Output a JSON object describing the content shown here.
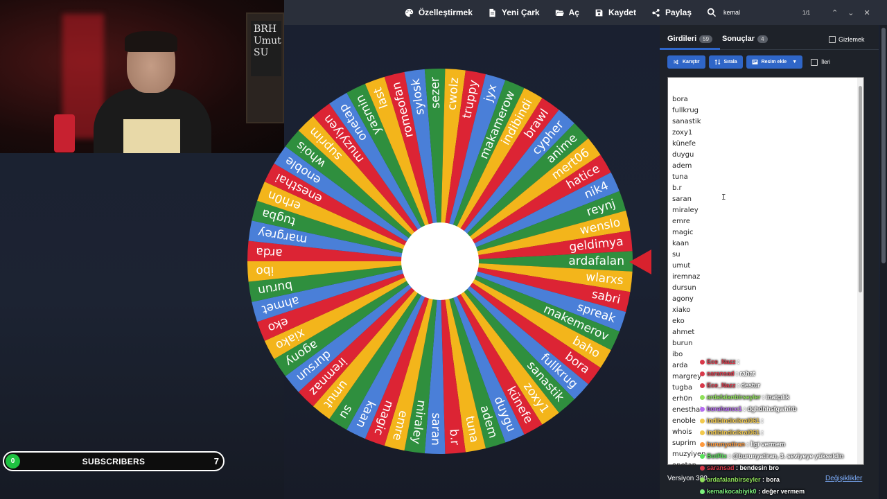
{
  "toolbar": {
    "customize_label": "Özelleştirmek",
    "new_wheel_label": "Yeni Çark",
    "open_label": "Aç",
    "save_label": "Kaydet",
    "share_label": "Paylaş",
    "search_value": "kemal",
    "search_count": "1/1"
  },
  "tabs": {
    "entries_label": "Girdileri",
    "entries_count": "59",
    "results_label": "Sonuçlar",
    "results_count": "4",
    "hide_label": "Gizlemek"
  },
  "actions": {
    "shuffle_label": "Karıştır",
    "sort_label": "Sırala",
    "add_image_label": "Resim ekle",
    "advanced_label": "İleri"
  },
  "entries": [
    "bora",
    "fullkrug",
    "sanastik",
    "zoxy1",
    "künefe",
    "duygu",
    "adem",
    "tuna",
    "b.r",
    "saran",
    "miraley",
    "emre",
    "magic",
    "kaan",
    "su",
    "umut",
    "iremnaz",
    "dursun",
    "agony",
    "xiako",
    "eko",
    "ahmet",
    "burun",
    "ibo",
    "arda",
    "margrey",
    "tugba",
    "erh0n",
    "enesthai",
    "enoble",
    "whois",
    "suprim",
    "muzyiyen",
    "onetap"
  ],
  "wheel": {
    "pointer_color": "#d8222e",
    "colors": [
      "#2f8f3e",
      "#f3b51b",
      "#dc2434",
      "#4a7fd8"
    ],
    "segments": [
      "ardafalan",
      "wlarxs",
      "sabri",
      "spreak",
      "makemerov",
      "baho",
      "bora",
      "fullkrug",
      "sanastik",
      "zoxy1",
      "künefe",
      "duygu",
      "adem",
      "tuna",
      "b.r",
      "saran",
      "miraley",
      "emre",
      "magic",
      "kaan",
      "su",
      "umut",
      "iremnaz",
      "dursun",
      "agony",
      "xiako",
      "eko",
      "ahmet",
      "burun",
      "ibo",
      "arda",
      "margrey",
      "tugba",
      "erh0n",
      "enesthai",
      "enoble",
      "whois",
      "suprim",
      "muzyiyen",
      "onetap",
      "yasmin",
      "last",
      "romeofan",
      "sylosk",
      "sezer",
      "cwolz",
      "truppy",
      "jyx",
      "makamerow",
      "indibindi",
      "brawl",
      "cypher",
      "anime",
      "mert06",
      "hatice",
      "nik4",
      "reynj",
      "wenslo",
      "geldimya"
    ]
  },
  "footer": {
    "version_label": "Versiyon 380",
    "changes_label": "Değişiklikler"
  },
  "chat": [
    {
      "user": "Ece_Nazz",
      "color": "#d8394a",
      "msg": ""
    },
    {
      "user": "saransad",
      "color": "#d8394a",
      "msg": "rahat"
    },
    {
      "user": "Ece_Nazz",
      "color": "#d8394a",
      "msg": "destur"
    },
    {
      "user": "ardafalanbirseyler",
      "color": "#8fe05a",
      "msg": "inatçılık"
    },
    {
      "user": "borahancc1",
      "color": "#b66bf2",
      "msg": "dghdhhsfgwhfrb"
    },
    {
      "user": "indibindicikral061",
      "color": "#f2c94c",
      "msg": ""
    },
    {
      "user": "indibindicikral061",
      "color": "#f2c94c",
      "msg": ""
    },
    {
      "user": "burunyatiran",
      "color": "#ff9a3d",
      "msg": "İlgi vermem"
    },
    {
      "user": "BotRix",
      "color": "#58e25a",
      "msg": "@burunyatiran, 3. seviyeye yükseldin"
    },
    {
      "user": "saransad",
      "color": "#d8394a",
      "msg": "bendesin bro"
    },
    {
      "user": "ardafalanbirseyler",
      "color": "#8fe05a",
      "msg": "bora"
    },
    {
      "user": "kemalkocabiyik0",
      "color": "#7cf07c",
      "msg": "değer vermem"
    }
  ],
  "subscribers": {
    "current": "0",
    "label": "SUBSCRIBERS",
    "goal": "7",
    "progress": 0
  },
  "webcam": {
    "chalkboard_text": "BRH\nUmut\nSU"
  }
}
